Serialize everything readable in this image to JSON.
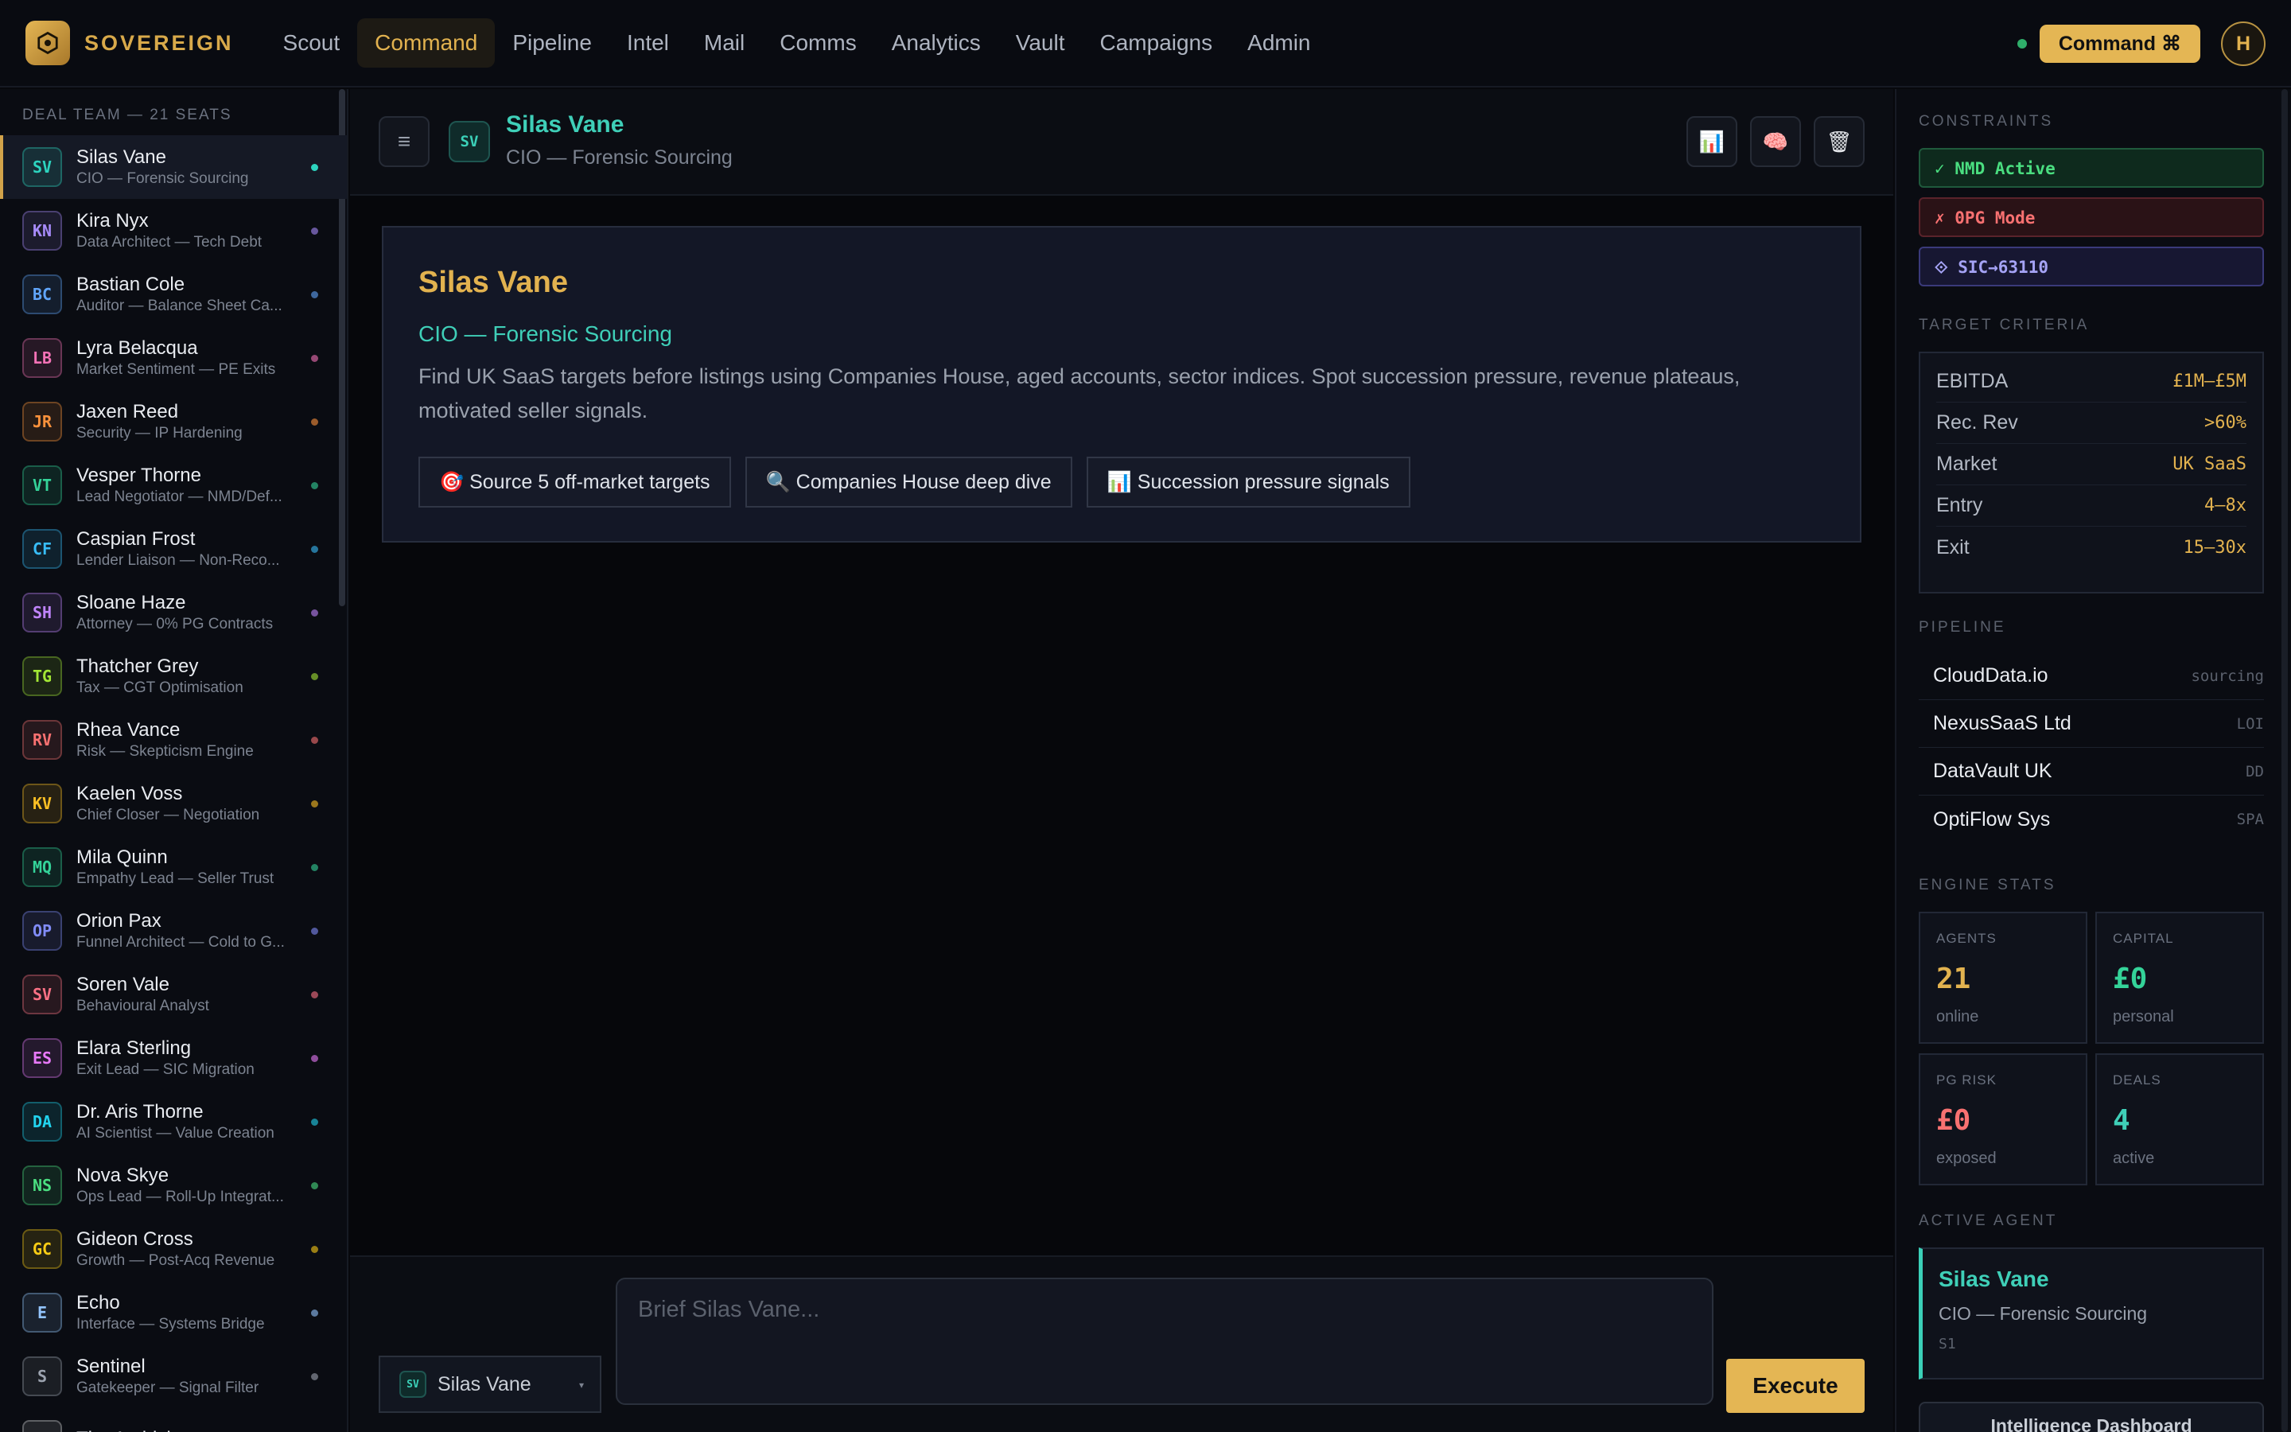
{
  "brand": {
    "name": "SOVEREIGN"
  },
  "nav": [
    {
      "label": "Scout"
    },
    {
      "label": "Command",
      "active": true
    },
    {
      "label": "Pipeline"
    },
    {
      "label": "Intel"
    },
    {
      "label": "Mail"
    },
    {
      "label": "Comms"
    },
    {
      "label": "Analytics"
    },
    {
      "label": "Vault"
    },
    {
      "label": "Campaigns"
    },
    {
      "label": "Admin"
    }
  ],
  "topbar": {
    "command_label": "Command ⌘",
    "user_initial": "H"
  },
  "team": {
    "header": "DEAL TEAM — 21 SEATS",
    "members": [
      {
        "initials": "SV",
        "name": "Silas Vane",
        "role": "CIO — Forensic Sourcing",
        "color": "#2dd4bf",
        "active": true
      },
      {
        "initials": "KN",
        "name": "Kira Nyx",
        "role": "Data Architect — Tech Debt",
        "color": "#a78bfa"
      },
      {
        "initials": "BC",
        "name": "Bastian Cole",
        "role": "Auditor — Balance Sheet Ca...",
        "color": "#60a5fa"
      },
      {
        "initials": "LB",
        "name": "Lyra Belacqua",
        "role": "Market Sentiment — PE Exits",
        "color": "#f472b6"
      },
      {
        "initials": "JR",
        "name": "Jaxen Reed",
        "role": "Security — IP Hardening",
        "color": "#fb923c"
      },
      {
        "initials": "VT",
        "name": "Vesper Thorne",
        "role": "Lead Negotiator — NMD/Def...",
        "color": "#34d399"
      },
      {
        "initials": "CF",
        "name": "Caspian Frost",
        "role": "Lender Liaison — Non-Reco...",
        "color": "#38bdf8"
      },
      {
        "initials": "SH",
        "name": "Sloane Haze",
        "role": "Attorney — 0% PG Contracts",
        "color": "#c084fc"
      },
      {
        "initials": "TG",
        "name": "Thatcher Grey",
        "role": "Tax — CGT Optimisation",
        "color": "#a3e635"
      },
      {
        "initials": "RV",
        "name": "Rhea Vance",
        "role": "Risk — Skepticism Engine",
        "color": "#f87171"
      },
      {
        "initials": "KV",
        "name": "Kaelen Voss",
        "role": "Chief Closer — Negotiation",
        "color": "#fbbf24"
      },
      {
        "initials": "MQ",
        "name": "Mila Quinn",
        "role": "Empathy Lead — Seller Trust",
        "color": "#34d399"
      },
      {
        "initials": "OP",
        "name": "Orion Pax",
        "role": "Funnel Architect — Cold to G...",
        "color": "#818cf8"
      },
      {
        "initials": "SV",
        "name": "Soren Vale",
        "role": "Behavioural Analyst",
        "color": "#fb7185"
      },
      {
        "initials": "ES",
        "name": "Elara Sterling",
        "role": "Exit Lead — SIC Migration",
        "color": "#e879f9"
      },
      {
        "initials": "DA",
        "name": "Dr. Aris Thorne",
        "role": "AI Scientist — Value Creation",
        "color": "#22d3ee"
      },
      {
        "initials": "NS",
        "name": "Nova Skye",
        "role": "Ops Lead — Roll-Up Integrat...",
        "color": "#4ade80"
      },
      {
        "initials": "GC",
        "name": "Gideon Cross",
        "role": "Growth — Post-Acq Revenue",
        "color": "#facc15"
      },
      {
        "initials": "E",
        "name": "Echo",
        "role": "Interface — Systems Bridge",
        "color": "#93c5fd"
      },
      {
        "initials": "S",
        "name": "Sentinel",
        "role": "Gatekeeper — Signal Filter",
        "color": "#9ca3af"
      },
      {
        "initials": "TA",
        "name": "The Archivist",
        "role": "",
        "color": "#d4d4d8"
      }
    ]
  },
  "agent": {
    "initials": "SV",
    "name": "Silas Vane",
    "role": "CIO — Forensic Sourcing",
    "description": "Find UK SaaS targets before listings using Companies House, aged accounts, sector indices. Spot succession pressure, revenue plateaus, motivated seller signals.",
    "actions": [
      {
        "icon": "🎯",
        "label": "Source 5 off-market targets"
      },
      {
        "icon": "🔍",
        "label": "Companies House deep dive"
      },
      {
        "icon": "📊",
        "label": "Succession pressure signals"
      }
    ]
  },
  "header_icons": {
    "chart": "📊",
    "brain": "🧠",
    "trash": "🗑"
  },
  "composer": {
    "selected_agent": "Silas Vane",
    "placeholder": "Brief Silas Vane...",
    "execute_label": "Execute"
  },
  "right_panel": {
    "constraints_title": "CONSTRAINTS",
    "constraints": [
      {
        "label": "✓ NMD Active",
        "status": "active"
      },
      {
        "label": "✗ 0PG Mode",
        "status": "off"
      },
      {
        "label": "⟐ SIC→63110",
        "status": "info"
      }
    ],
    "criteria_title": "TARGET CRITERIA",
    "criteria": [
      {
        "label": "EBITDA",
        "value": "£1M–£5M"
      },
      {
        "label": "Rec. Rev",
        "value": ">60%"
      },
      {
        "label": "Market",
        "value": "UK SaaS"
      },
      {
        "label": "Entry",
        "value": "4–8x"
      },
      {
        "label": "Exit",
        "value": "15–30x"
      }
    ],
    "pipeline_title": "PIPELINE",
    "pipeline": [
      {
        "name": "CloudData.io",
        "stage": "sourcing"
      },
      {
        "name": "NexusSaaS Ltd",
        "stage": "LOI"
      },
      {
        "name": "DataVault UK",
        "stage": "DD"
      },
      {
        "name": "OptiFlow Sys",
        "stage": "SPA"
      }
    ],
    "stats_title": "ENGINE STATS",
    "stats": [
      {
        "label": "AGENTS",
        "value": "21",
        "sub": "online",
        "color": "#e2b24f"
      },
      {
        "label": "CAPITAL",
        "value": "£0",
        "sub": "personal",
        "color": "#34d399"
      },
      {
        "label": "PG RISK",
        "value": "£0",
        "sub": "exposed",
        "color": "#f87171"
      },
      {
        "label": "DEALS",
        "value": "4",
        "sub": "active",
        "color": "#3fcfb8"
      }
    ],
    "active_title": "ACTIVE AGENT",
    "active_agent": {
      "name": "Silas Vane",
      "role": "CIO — Forensic Sourcing",
      "id": "S1"
    },
    "dashboard_label": "Intelligence Dashboard"
  }
}
